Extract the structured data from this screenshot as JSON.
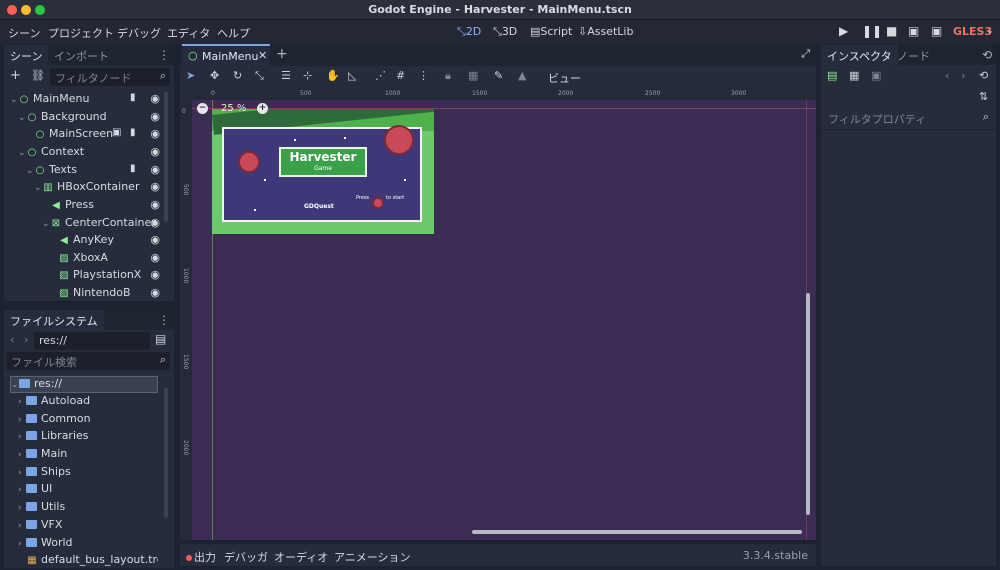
{
  "window": {
    "title": "Godot Engine - Harvester - MainMenu.tscn"
  },
  "menu": [
    "シーン",
    "プロジェクト",
    "デバッグ",
    "エディタ",
    "ヘルプ"
  ],
  "workspaces": [
    "2D",
    "3D",
    "Script",
    "AssetLib"
  ],
  "renderer": "GLES3",
  "scene_panel": {
    "tabs": [
      "シーン",
      "インポート"
    ],
    "filter_placeholder": "フィルタノード",
    "tree": [
      {
        "label": "MainMenu",
        "icon": "node2d-icon"
      },
      {
        "label": "Background",
        "icon": "node2d-icon"
      },
      {
        "label": "MainScreen",
        "icon": "node2d-icon"
      },
      {
        "label": "Context",
        "icon": "node2d-icon"
      },
      {
        "label": "Texts",
        "icon": "node2d-icon"
      },
      {
        "label": "HBoxContainer",
        "icon": "hbox-icon"
      },
      {
        "label": "Press",
        "icon": "label-icon"
      },
      {
        "label": "CenterContainer",
        "icon": "center-container-icon"
      },
      {
        "label": "AnyKey",
        "icon": "label-icon"
      },
      {
        "label": "XboxA",
        "icon": "texture-rect-icon"
      },
      {
        "label": "PlaystationX",
        "icon": "texture-rect-icon"
      },
      {
        "label": "NintendoB",
        "icon": "texture-rect-icon"
      }
    ]
  },
  "filesystem_panel": {
    "tab": "ファイルシステム",
    "path": "res://",
    "search_placeholder": "ファイル検索",
    "root": "res://",
    "folders": [
      "Autoload",
      "Common",
      "Libraries",
      "Main",
      "Ships",
      "UI",
      "Utils",
      "VFX",
      "World"
    ],
    "file": "default_bus_layout.tres"
  },
  "editor": {
    "tab": "MainMenu",
    "view_menu": "ビュー",
    "zoom": "25 %",
    "ruler_labels": [
      "0",
      "500",
      "1000",
      "1500",
      "2000",
      "2500",
      "3000"
    ],
    "ruler_v_labels": [
      "0",
      "500",
      "1000",
      "1500",
      "2000"
    ]
  },
  "game_preview": {
    "logo_title": "Harvester",
    "logo_subtitle": "Game",
    "press": "Press",
    "to_start": "to start",
    "brand": "GDQuest"
  },
  "inspector": {
    "tabs": [
      "インスペクタ",
      "ノード"
    ],
    "filter_placeholder": "フィルタプロパティ"
  },
  "bottom": {
    "items": [
      "出力",
      "デバッガ",
      "オーディオ",
      "アニメーション"
    ],
    "version": "3.3.4.stable"
  }
}
